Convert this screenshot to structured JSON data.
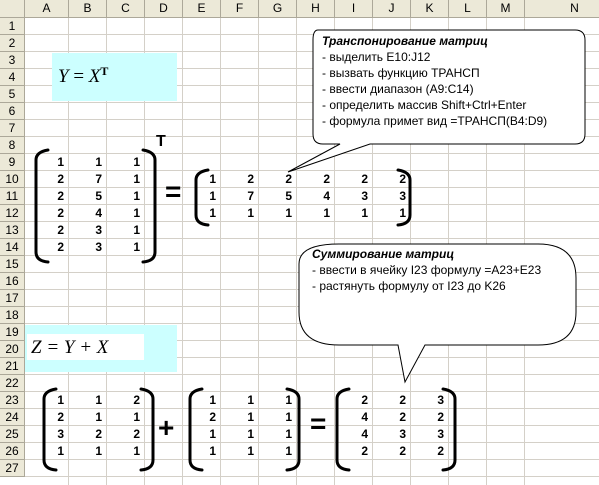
{
  "columns": [
    "A",
    "B",
    "C",
    "D",
    "E",
    "F",
    "G",
    "H",
    "I",
    "J",
    "K",
    "L",
    "M",
    "N"
  ],
  "rows": [
    "1",
    "2",
    "3",
    "4",
    "5",
    "6",
    "7",
    "8",
    "9",
    "10",
    "11",
    "12",
    "13",
    "14",
    "15",
    "16",
    "17",
    "18",
    "19",
    "20",
    "21",
    "22",
    "23",
    "24",
    "25",
    "26",
    "27"
  ],
  "formula_top": {
    "lhs": "Y",
    "eq": "=",
    "rhs": "X",
    "sup": "T"
  },
  "formula_bottom": {
    "text": "Z = Y + X"
  },
  "transpose_mark": "T",
  "ops": {
    "eq1": "=",
    "plus": "+",
    "eq2": "="
  },
  "callout_transpose": {
    "title": "Транспонирование матриц",
    "lines": [
      "- выделить E10:J12",
      "- вызвать функцию ТРАНСП",
      "- ввести диапазон (A9:C14)",
      "- определить массив Shift+Ctrl+Enter",
      "- формула примет вид =ТРАНСП(B4:D9)"
    ]
  },
  "callout_sum": {
    "title": "Суммирование матриц",
    "lines": [
      "- ввести в ячейку I23 формулу =A23+E23",
      "- растянуть формулу от I23 до K26"
    ]
  },
  "matrix_X": [
    [
      "1",
      "1",
      "1"
    ],
    [
      "2",
      "7",
      "1"
    ],
    [
      "2",
      "5",
      "1"
    ],
    [
      "2",
      "4",
      "1"
    ],
    [
      "2",
      "3",
      "1"
    ],
    [
      "2",
      "3",
      "1"
    ]
  ],
  "matrix_Y": [
    [
      "1",
      "2",
      "2",
      "2",
      "2",
      "2"
    ],
    [
      "1",
      "7",
      "5",
      "4",
      "3",
      "3"
    ],
    [
      "1",
      "1",
      "1",
      "1",
      "1",
      "1"
    ]
  ],
  "matrix_A": [
    [
      "1",
      "1",
      "2"
    ],
    [
      "2",
      "1",
      "1"
    ],
    [
      "3",
      "2",
      "2"
    ],
    [
      "1",
      "1",
      "1"
    ]
  ],
  "matrix_B": [
    [
      "1",
      "1",
      "1"
    ],
    [
      "2",
      "1",
      "1"
    ],
    [
      "1",
      "1",
      "1"
    ],
    [
      "1",
      "1",
      "1"
    ]
  ],
  "matrix_Z": [
    [
      "2",
      "2",
      "3"
    ],
    [
      "4",
      "2",
      "2"
    ],
    [
      "4",
      "3",
      "3"
    ],
    [
      "2",
      "2",
      "2"
    ]
  ]
}
